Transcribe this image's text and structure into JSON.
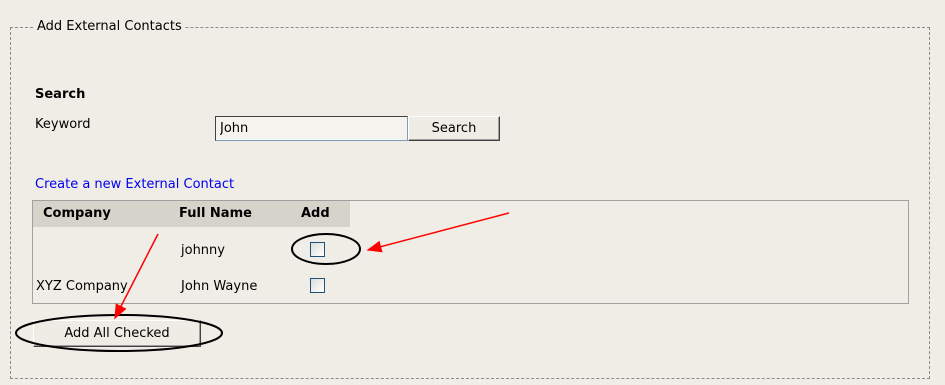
{
  "section": {
    "legend": "Add External Contacts"
  },
  "search": {
    "title": "Search",
    "keyword_label": "Keyword",
    "keyword_value": "John",
    "button_label": "Search"
  },
  "create_link": "Create a new External Contact",
  "table": {
    "headers": [
      "Company",
      "Full Name",
      "Add"
    ],
    "rows": [
      {
        "company": "",
        "full_name": "johnny",
        "add_checked": false
      },
      {
        "company": "XYZ Company",
        "full_name": "John Wayne",
        "add_checked": false
      }
    ]
  },
  "add_all_label": "Add All Checked",
  "annotation_color": "#ff0000"
}
